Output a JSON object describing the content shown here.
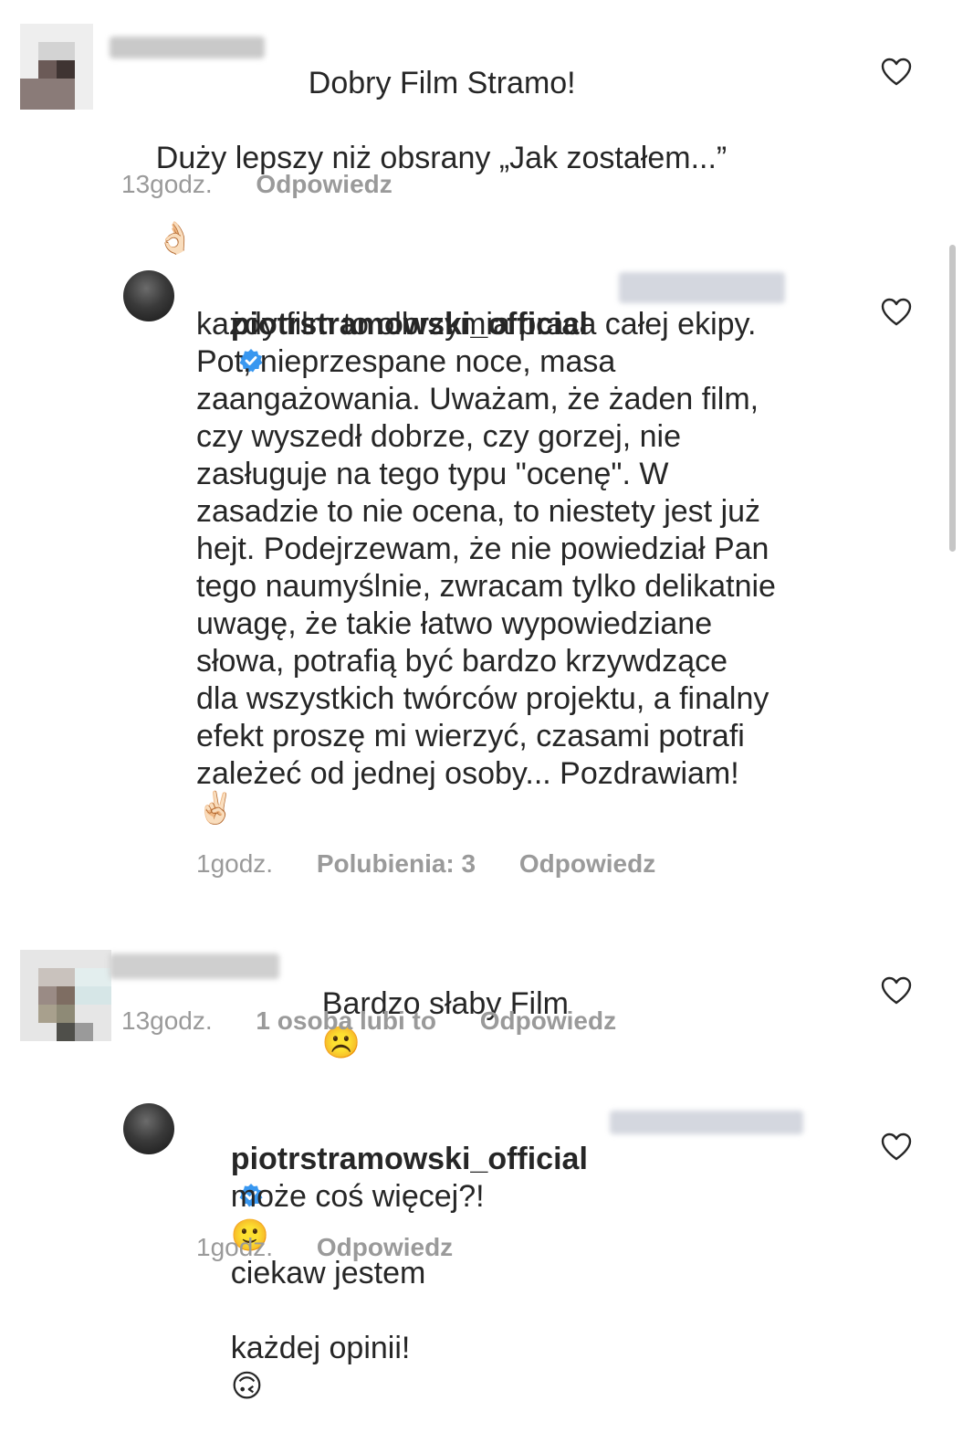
{
  "comments": [
    {
      "text_line1": "Dobry Film Stramo!",
      "text_line2": "Duży lepszy niż obsrany „Jak zostałem...”",
      "emoji": "👌🏻",
      "time": "13godz.",
      "reply": "Odpowiedz"
    },
    {
      "username": "piotrstramowski_official",
      "body": "każdy film to olbrzymia praca całej ekipy.\nPot, nieprzespane noce, masa\nzaangażowania. Uważam, że żaden film,\nczy wyszedł dobrze, czy gorzej, nie\nzasługuje na tego typu \"ocenę\". W\nzasadzie to nie ocena, to niestety jest już\nhejt. Podejrzewam, że nie powiedział Pan\ntego naumyślnie, zwracam tylko delikatnie\nuwagę, że takie łatwo wypowiedziane\nsłowa, potrafią być bardzo krzywdzące\ndla wszystkich twórców projektu, a finalny\nefekt proszę mi wierzyć, czasami potrafi\nzależeć od jednej osoby... Pozdrawiam!",
      "emoji": "✌🏻",
      "time": "1godz.",
      "likes": "Polubienia: 3",
      "reply": "Odpowiedz"
    },
    {
      "text": "Bardzo słaby Film",
      "emoji": "☹️",
      "time": "13godz.",
      "likes": "1 osoba lubi to",
      "reply": "Odpowiedz"
    },
    {
      "username": "piotrstramowski_official",
      "body_part1": "może coś więcej?!",
      "emoji1": "🙂",
      "body_part2": "ciekaw jestem",
      "body_line2": "każdej opinii!",
      "emoji2": "🙃",
      "time": "1godz.",
      "reply": "Odpowiedz"
    }
  ],
  "icons": {
    "like": "heart-icon",
    "verified": "verified-badge-icon"
  },
  "colors": {
    "meta": "#9a9a9a",
    "verified": "#3897f0",
    "text": "#262626"
  }
}
